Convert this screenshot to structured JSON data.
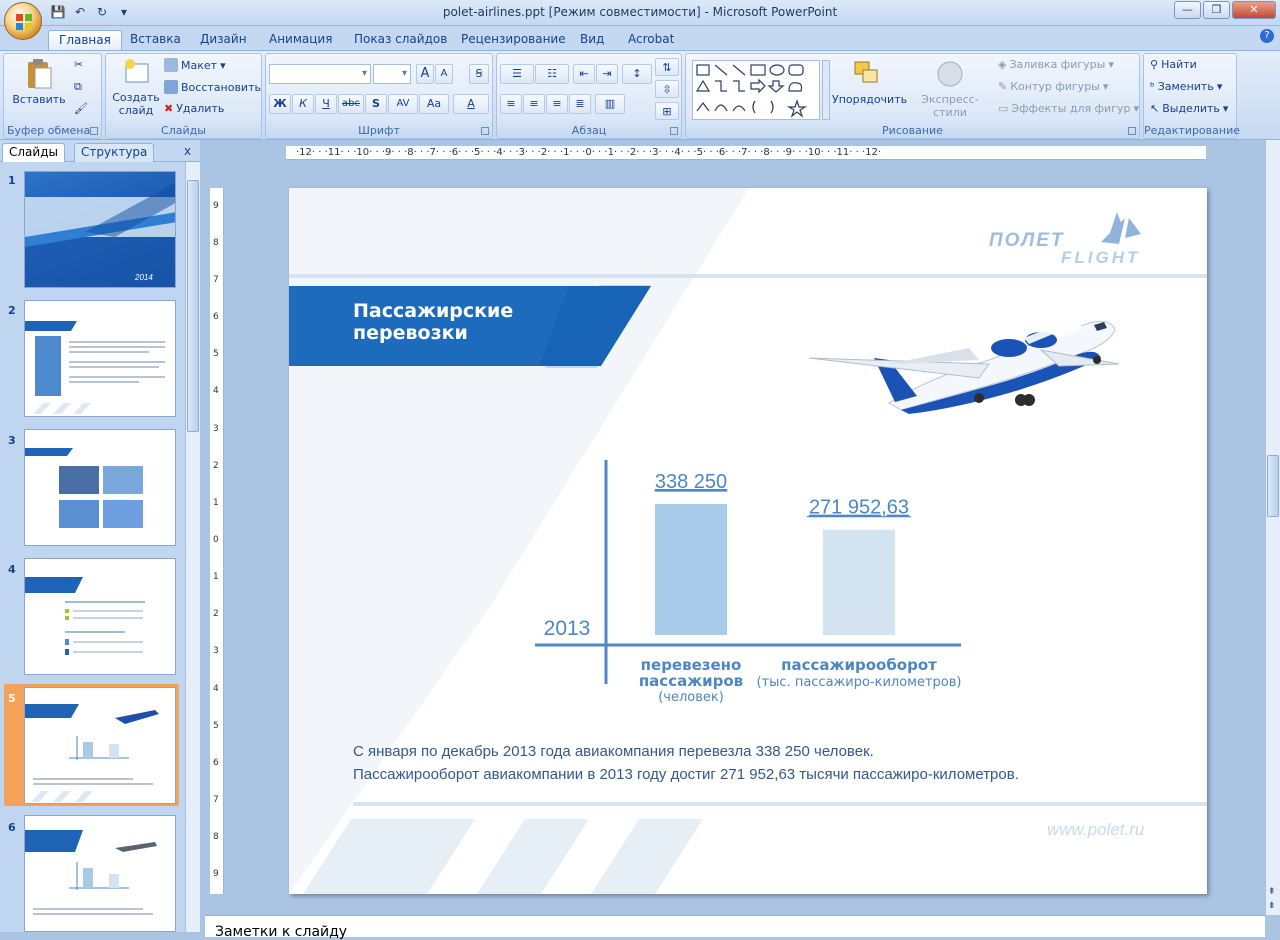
{
  "window": {
    "title": "polet-airlines.ppt [Режим совместимости] - Microsoft PowerPoint",
    "buttons": [
      "—",
      "❐",
      "✕"
    ]
  },
  "ribbon_tabs": [
    "Главная",
    "Вставка",
    "Дизайн",
    "Анимация",
    "Показ слайдов",
    "Рецензирование",
    "Вид",
    "Acrobat"
  ],
  "help_label": "?",
  "groups": {
    "clipboard": {
      "label": "Буфер обмена",
      "paste": "Вставить"
    },
    "slides": {
      "label": "Слайды",
      "new_slide": "Создать слайд",
      "layout": "Макет",
      "reset": "Восстановить",
      "delete": "Удалить"
    },
    "font": {
      "label": "Шрифт",
      "bold": "Ж",
      "italic": "К",
      "underline": "Ч",
      "strike": "abc",
      "shadow": "S",
      "spacing": "AV",
      "case": "Aa",
      "grow": "A",
      "shrink": "A",
      "color": "A"
    },
    "paragraph": {
      "label": "Абзац"
    },
    "drawing": {
      "label": "Рисование",
      "arrange": "Упорядочить",
      "quick_styles": "Экспресс-стили",
      "fill": "Заливка фигуры",
      "outline": "Контур фигуры",
      "effects": "Эффекты для фигур"
    },
    "editing": {
      "label": "Редактирование",
      "find": "Найти",
      "replace": "Заменить",
      "select": "Выделить"
    }
  },
  "pane": {
    "tab_slides": "Слайды",
    "tab_outline": "Структура",
    "close": "x"
  },
  "thumbs": [
    {
      "num": "1",
      "year": "2014"
    },
    {
      "num": "2"
    },
    {
      "num": "3"
    },
    {
      "num": "4"
    },
    {
      "num": "5"
    },
    {
      "num": "6"
    }
  ],
  "ruler_h": "·12· · ·11· · ·10· · ·9· · ·8· · ·7· · ·6· · ·5· · ·4· · ·3· · ·2· · ·1· · ·0· · ·1· · ·2· · ·3· · ·4· · ·5· · ·6· · ·7· · ·8· · ·9· · ·10· · ·11· · ·12·",
  "ruler_v": [
    "9",
    "8",
    "7",
    "6",
    "5",
    "4",
    "3",
    "2",
    "1",
    "0",
    "1",
    "2",
    "3",
    "4",
    "5",
    "6",
    "7",
    "8",
    "9"
  ],
  "slide": {
    "title_line1": "Пассажирские",
    "title_line2": "перевозки",
    "logo_line1": "ПОЛЕТ",
    "logo_line2": "FLIGHT",
    "website": "www.polet.ru",
    "body_line1": "С января по декабрь 2013 года авиакомпания перевезла 338 250 человек.",
    "body_line2": "Пассажирооборот авиакомпании в 2013 году достиг 271 952,63 тысячи пассажиро-километров."
  },
  "chart_data": {
    "type": "bar",
    "categories": [
      "перевезено пассажиров",
      "пассажирооборот"
    ],
    "category_sub": [
      "(человек)",
      "(тыс. пассажиро-километров)"
    ],
    "series": [
      {
        "values": [
          338250,
          271952.63
        ]
      }
    ],
    "value_labels": [
      "338 250",
      "271 952,63"
    ],
    "year_label": "2013",
    "colors": [
      "#a8cbea",
      "#d3e3f0"
    ],
    "label_color": "#4c86c3"
  },
  "notes_placeholder": "Заметки к слайду"
}
